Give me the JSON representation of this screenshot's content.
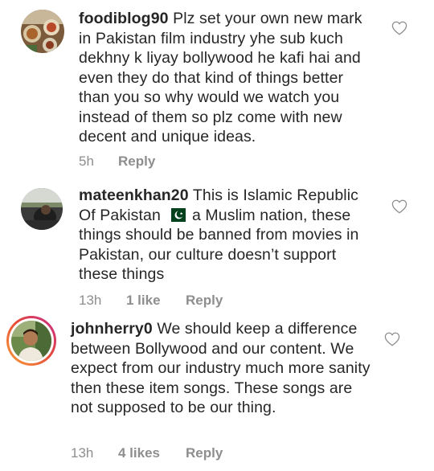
{
  "comments": [
    {
      "username": "foodiblog90",
      "text": "Plz set your own new mark in Pakistan film industry yhe sub kuch dekhny k liyay bollywood he kafi hai and even they do that kind of things better than you so why would we watch you instead of them so plz come with new decent and unique ideas.",
      "time": "5h",
      "likes": "",
      "reply_label": "Reply"
    },
    {
      "username": "mateenkhan20",
      "text_before_flag": "This is Islamic Republic Of Pakistan",
      "flag_icon": "pakistan-flag-emoji",
      "text_after_flag": "a Muslim nation, these things should be banned from movies in Pakistan, our culture doesn’t support these things",
      "time": "13h",
      "likes": "1 like",
      "reply_label": "Reply"
    },
    {
      "username": "johnherry0",
      "text": "We should keep a difference between Bollywood and our content. We expect from our industry much more sanity then these item songs. These songs are not supposed to be our thing.",
      "time": "13h",
      "likes": "4 likes",
      "reply_label": "Reply"
    }
  ],
  "icons": {
    "like": "heart-outline-icon"
  },
  "colors": {
    "text": "#262626",
    "meta": "#8e8e8e",
    "story_ring_start": "#f9a23a",
    "story_ring_end": "#c62b8f",
    "flag_green": "#01411c"
  }
}
